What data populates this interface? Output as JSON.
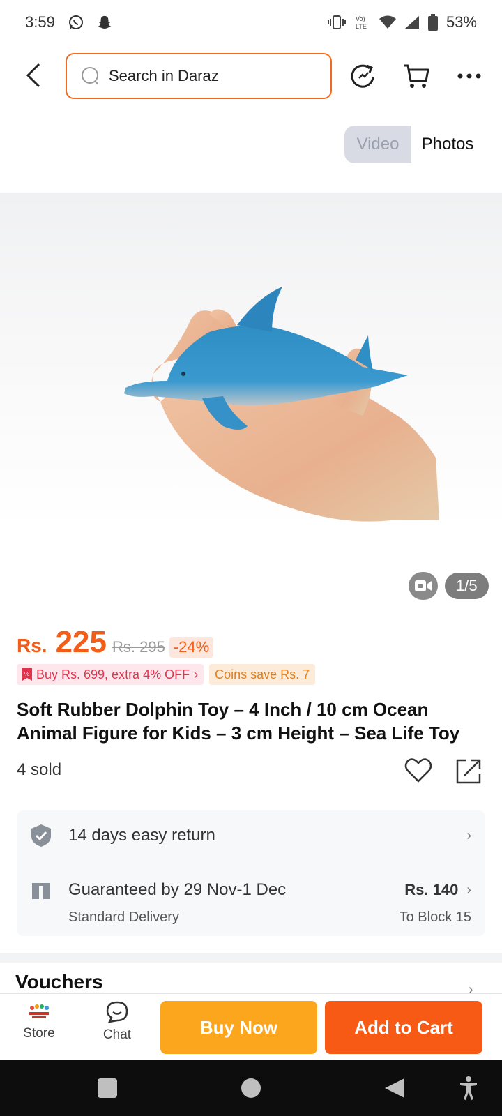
{
  "status_bar": {
    "time": "3:59",
    "battery": "53%"
  },
  "top_bar": {
    "search_placeholder": "Search in Daraz"
  },
  "media_toggle": {
    "video_label": "Video",
    "photos_label": "Photos"
  },
  "gallery": {
    "page_indicator": "1/5"
  },
  "price": {
    "currency": "Rs.",
    "value": "225",
    "original": "Rs. 295",
    "discount": "-24%"
  },
  "promos": {
    "bundle_offer": "Buy Rs. 699, extra 4% OFF",
    "coins": "Coins save Rs. 7"
  },
  "product": {
    "title": "Soft Rubber Dolphin Toy – 4 Inch / 10 cm Ocean Animal Figure for Kids – 3 cm Height – Sea Life Toy",
    "sold": "4 sold"
  },
  "services": {
    "return_label": "14 days easy return",
    "delivery_label": "Guaranteed by 29 Nov-1 Dec",
    "delivery_fee": "Rs. 140",
    "delivery_type": "Standard Delivery",
    "delivery_location": "To Block 15"
  },
  "sections": {
    "vouchers": "Vouchers"
  },
  "action_bar": {
    "store_label": "Store",
    "chat_label": "Chat",
    "buy_now": "Buy Now",
    "add_to_cart": "Add to Cart"
  },
  "colors": {
    "accent": "#f25d19",
    "buy_now": "#fca61e",
    "add_to_cart": "#f75a14",
    "search_border": "#f26a21"
  }
}
